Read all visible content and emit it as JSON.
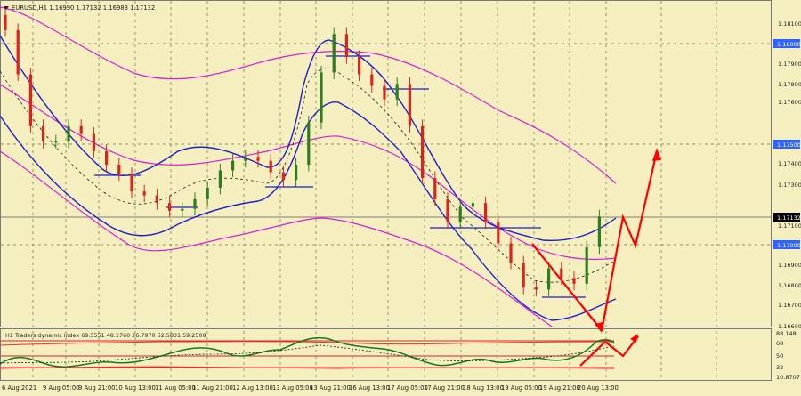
{
  "chart_title": "EURUSD,H1  1.16990 1.17132 1.16983 1.17132",
  "indicator_title": "H1 Traders dynamic index 69.5551 48.1760 26.7970 62.5831 59.2509",
  "price_axis": {
    "ticks": [
      "1.18100",
      "1.17900",
      "1.17800",
      "1.17600",
      "1.17400",
      "1.17300",
      "1.17100",
      "1.16900",
      "1.16800",
      "1.16700",
      "1.16600"
    ],
    "highlighted": [
      "1.18000",
      "1.17500",
      "1.17132",
      "1.17000"
    ],
    "ylim": [
      1.1658,
      1.1822
    ]
  },
  "indicator_axis": {
    "ticks": [
      "88.148",
      "68",
      "50",
      "32",
      "10.8707"
    ],
    "ylim": [
      10.8707,
      88.148
    ]
  },
  "time_axis": {
    "labels": [
      "6 Aug 2021",
      "9 Aug 05:00",
      "9 Aug 21:00",
      "10 Aug 13:00",
      "11 Aug 05:00",
      "11 Aug 21:00",
      "12 Aug 13:00",
      "13 Aug 05:00",
      "13 Aug 21:00",
      "16 Aug 13:00",
      "17 Aug 05:00",
      "17 Aug 21:00",
      "18 Aug 13:00",
      "19 Aug 05:00",
      "19 Aug 21:00",
      "20 Aug 13:00"
    ]
  },
  "colors": {
    "background": "#f5eebf",
    "bull_candle": "#2e7d1e",
    "bear_candle": "#d7261b",
    "band_outer": "#d71dd7",
    "band_inner": "#1f20c8",
    "projection_arrow": "#ff0000",
    "highlight_label": "#2f63ff",
    "grid": "#6f6f40"
  },
  "chart_data": {
    "type": "candlestick",
    "series_close_approx": [
      1.181,
      1.1787,
      1.176,
      1.1752,
      1.1752,
      1.176,
      1.1756,
      1.1747,
      1.174,
      1.1735,
      1.1726,
      1.1724,
      1.172,
      1.1716,
      1.1717,
      1.1722,
      1.1728,
      1.1737,
      1.1742,
      1.1744,
      1.1742,
      1.1736,
      1.1732,
      1.174,
      1.1762,
      1.1788,
      1.1808,
      1.1796,
      1.1787,
      1.1781,
      1.1774,
      1.1782,
      1.176,
      1.1733,
      1.1722,
      1.171,
      1.1718,
      1.172,
      1.171,
      1.1699,
      1.1689,
      1.1676,
      1.1675,
      1.1686,
      1.1681,
      1.1678,
      1.1697,
      1.1713
    ]
  }
}
